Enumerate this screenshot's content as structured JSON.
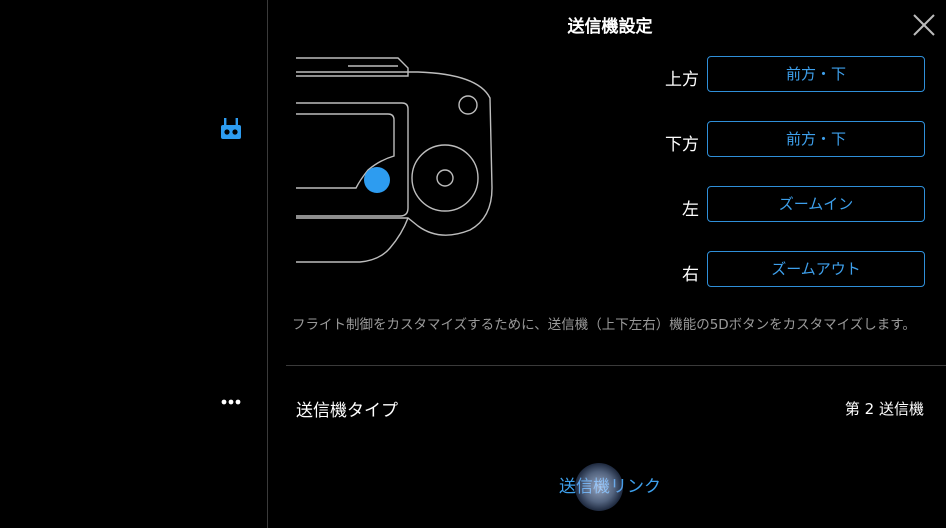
{
  "header": {
    "title": "送信機設定"
  },
  "directions": [
    {
      "label": "上方",
      "value": "前方・下"
    },
    {
      "label": "下方",
      "value": "前方・下"
    },
    {
      "label": "左",
      "value": "ズームイン"
    },
    {
      "label": "右",
      "value": "ズームアウト"
    }
  ],
  "description": "フライト制御をカスタマイズするために、送信機（上下左右）機能の5Dボタンをカスタマイズします。",
  "rc_type": {
    "label": "送信機タイプ",
    "value": "第 2 送信機"
  },
  "link_button": {
    "label": "送信機リンク"
  },
  "icons": {
    "sidebar_top": "remote-controller-icon",
    "sidebar_bottom": "more-icon",
    "close": "close-icon"
  },
  "colors": {
    "accent": "#2f8fd9",
    "background": "#000000",
    "highlight_dot": "#2d9cf0"
  }
}
